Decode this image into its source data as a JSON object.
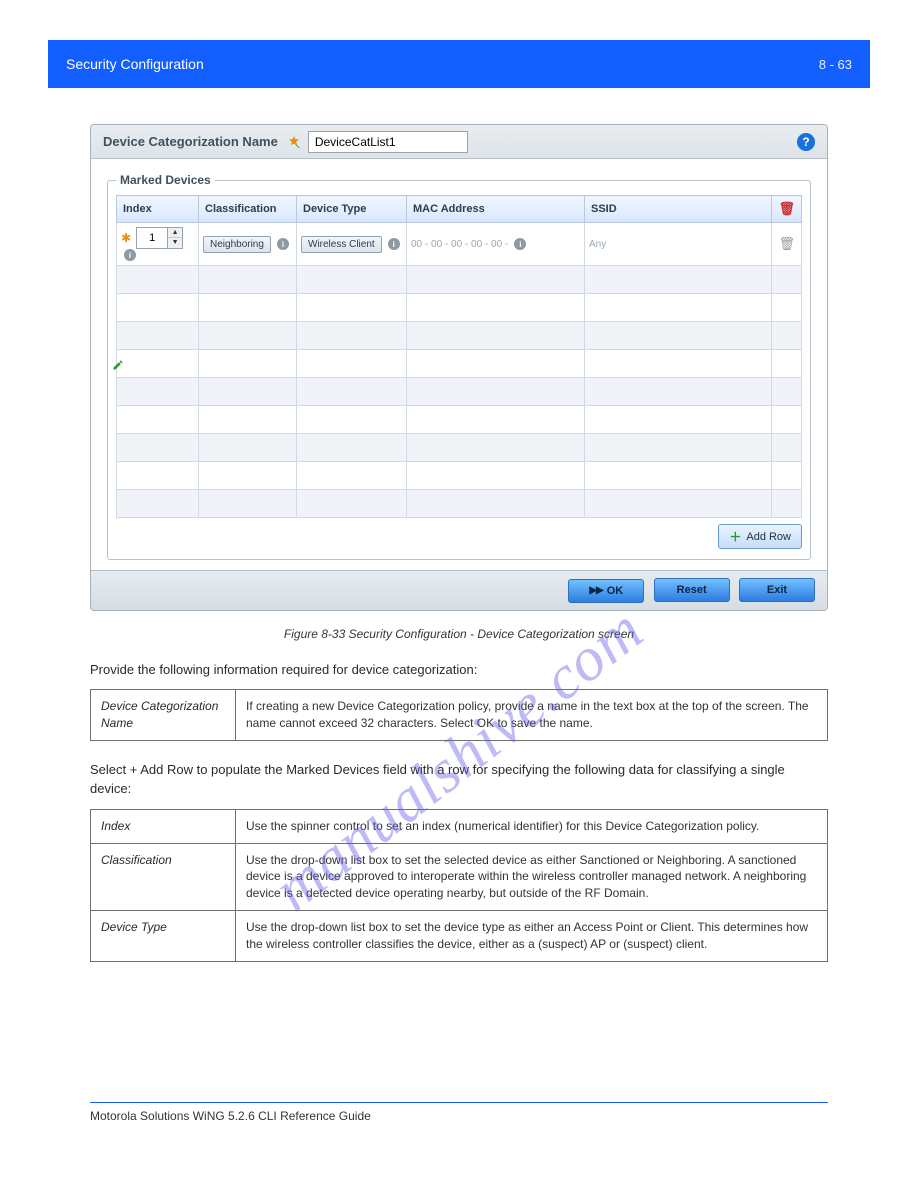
{
  "banner": {
    "left": "Security Configuration",
    "right": "8 - 63"
  },
  "dialog": {
    "titleLabel": "Device Categorization Name",
    "nameValue": "DeviceCatList1",
    "helpLabel": "?",
    "markedLegend": "Marked Devices",
    "columns": {
      "index": "Index",
      "classification": "Classification",
      "deviceType": "Device Type",
      "mac": "MAC Address",
      "ssid": "SSID"
    },
    "row1": {
      "index": "1",
      "classification": "Neighboring",
      "deviceType": "Wireless Client",
      "mac": "00 - 00 - 00 - 00 - 00 -",
      "ssid": "Any"
    },
    "addRowLabel": "Add Row",
    "okLabel": "OK",
    "resetLabel": "Reset",
    "exitLabel": "Exit"
  },
  "figureCaption": "Figure 8-33 Security Configuration - Device Categorization screen",
  "paraIntro": "Provide the following information required for device categorization:",
  "paraAfter": "Select + Add Row to populate the Marked Devices field with a row for specifying the following data for classifying a single device:",
  "params": [
    {
      "label": "Device Categorization Name",
      "text": "If creating a new Device Categorization policy, provide a name in the text box at the top of the screen. The name cannot exceed 32 characters. Select OK to save the name."
    },
    {
      "label": "Index",
      "text": "Use the spinner control to set an index (numerical identifier) for this Device Categorization policy."
    },
    {
      "label": "Classification",
      "text": "Use the drop-down list box to set the selected device as either Sanctioned or Neighboring. A sanctioned device is a device approved to interoperate within the wireless controller managed network. A neighboring device is a detected device operating nearby, but outside of the RF Domain."
    },
    {
      "label": "Device Type",
      "text": "Use the drop-down list box to set the device type as either an Access Point or Client. This determines how the wireless controller classifies the device, either as a (suspect) AP or (suspect) client."
    }
  ],
  "watermark": "manualshive.com",
  "footer": {
    "left": "Motorola Solutions WiNG 5.2.6 CLI Reference Guide",
    "right": ""
  }
}
